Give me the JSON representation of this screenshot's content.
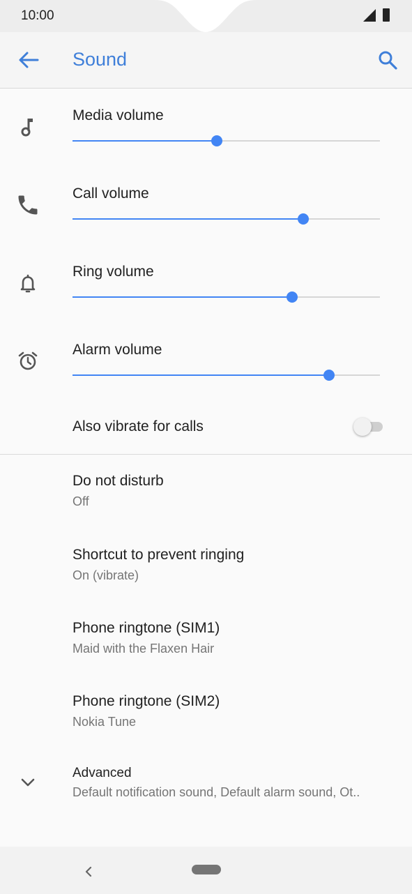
{
  "status_bar": {
    "time": "10:00"
  },
  "app_bar": {
    "title": "Sound"
  },
  "sliders": [
    {
      "label": "Media volume",
      "icon": "music-note-icon",
      "level": 0.47
    },
    {
      "label": "Call volume",
      "icon": "phone-icon",
      "level": 0.75
    },
    {
      "label": "Ring volume",
      "icon": "bell-icon",
      "level": 0.715
    },
    {
      "label": "Alarm volume",
      "icon": "alarm-clock-icon",
      "level": 0.835
    }
  ],
  "vibrate": {
    "label": "Also vibrate for calls",
    "enabled": false
  },
  "prefs": [
    {
      "title": "Do not disturb",
      "summary": "Off"
    },
    {
      "title": "Shortcut to prevent ringing",
      "summary": "On (vibrate)"
    },
    {
      "title": "Phone ringtone (SIM1)",
      "summary": "Maid with the Flaxen Hair"
    },
    {
      "title": "Phone ringtone (SIM2)",
      "summary": "Nokia Tune"
    }
  ],
  "advanced": {
    "title": "Advanced",
    "summary": "Default notification sound, Default alarm sound, Ot.."
  },
  "colors": {
    "accent": "#4285f4",
    "title": "#3f7fd9",
    "background": "#fafafa"
  }
}
